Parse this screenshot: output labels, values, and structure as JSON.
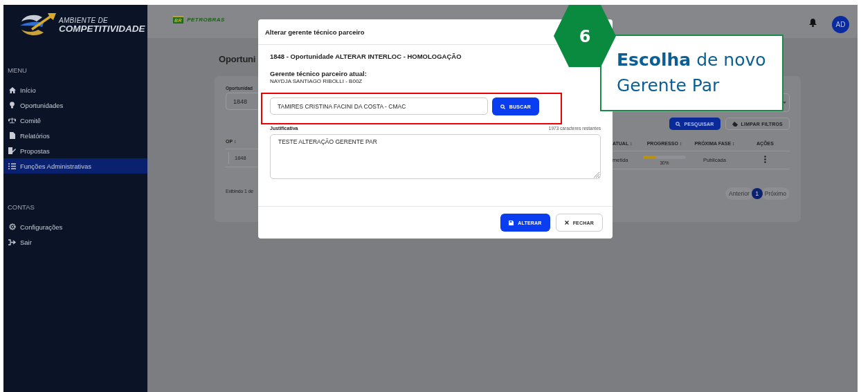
{
  "sidebar": {
    "logo_line1": "AMBIENTE DE",
    "logo_line2": "COMPETITIVIDADE",
    "sections": [
      {
        "heading": "MENU",
        "items": [
          {
            "label": "Início",
            "selected": false
          },
          {
            "label": "Oportunidades",
            "selected": false
          },
          {
            "label": "Comitê",
            "selected": false
          },
          {
            "label": "Relatórios",
            "selected": false
          },
          {
            "label": "Propostas",
            "selected": false
          },
          {
            "label": "Funções Administrativas",
            "selected": true
          }
        ]
      },
      {
        "heading": "CONTAS",
        "items": [
          {
            "label": "Configurações",
            "selected": false
          },
          {
            "label": "Sair",
            "selected": false
          }
        ]
      }
    ]
  },
  "header": {
    "brand_badge": "BR",
    "brand": "PETROBRAS",
    "avatar": "AD"
  },
  "page": {
    "title": "Oportuni",
    "filter_label": "Oportunidad",
    "filter_value": "1848",
    "buttons": [
      {
        "label": "PESQUISAR",
        "kind": "primary"
      },
      {
        "label": "LIMPAR FILTROS",
        "kind": "secondary"
      }
    ],
    "columns": [
      "OP ↕",
      "ATUAL ↕",
      "PROGRESSO ↕",
      "PRÓXIMA FASE ↕",
      "AÇÕES"
    ],
    "row": {
      "op": "1848",
      "status": "metida",
      "progress": {
        "level": 0.3,
        "reading": "30%"
      },
      "next_phase": "Publicada"
    },
    "summary": "Exibindo 1 de",
    "pagination": {
      "prev": "Anterior",
      "pages": [
        {
          "label": "1",
          "selected": true
        }
      ],
      "next": "Próximo"
    }
  },
  "modal": {
    "title": "Alterar gerente técnico parceiro",
    "subtitle": "1848 - Oportunidade ALTERAR INTERLOC - HOMOLOGAÇÃO",
    "current_label": "Gerente técnico parceiro atual:",
    "current_value": "NAYDJA SANTIAGO RIBOLLI - B00Z",
    "search_value": "TAMIRES CRISTINA FACINI DA COSTA - CMAC",
    "search_button": "BUSCAR",
    "justification_label": "Justificativa",
    "char_count": "1973 caracteres restantes",
    "justification_value": "TESTE ALTERAÇÃO GERENTE PAR",
    "buttons": [
      {
        "label": "ALTERAR",
        "kind": "primary"
      },
      {
        "label": "FECHAR",
        "kind": "secondary"
      }
    ]
  },
  "tour": {
    "step": "6",
    "text": "**Escolha** de novo Gerente Par"
  }
}
